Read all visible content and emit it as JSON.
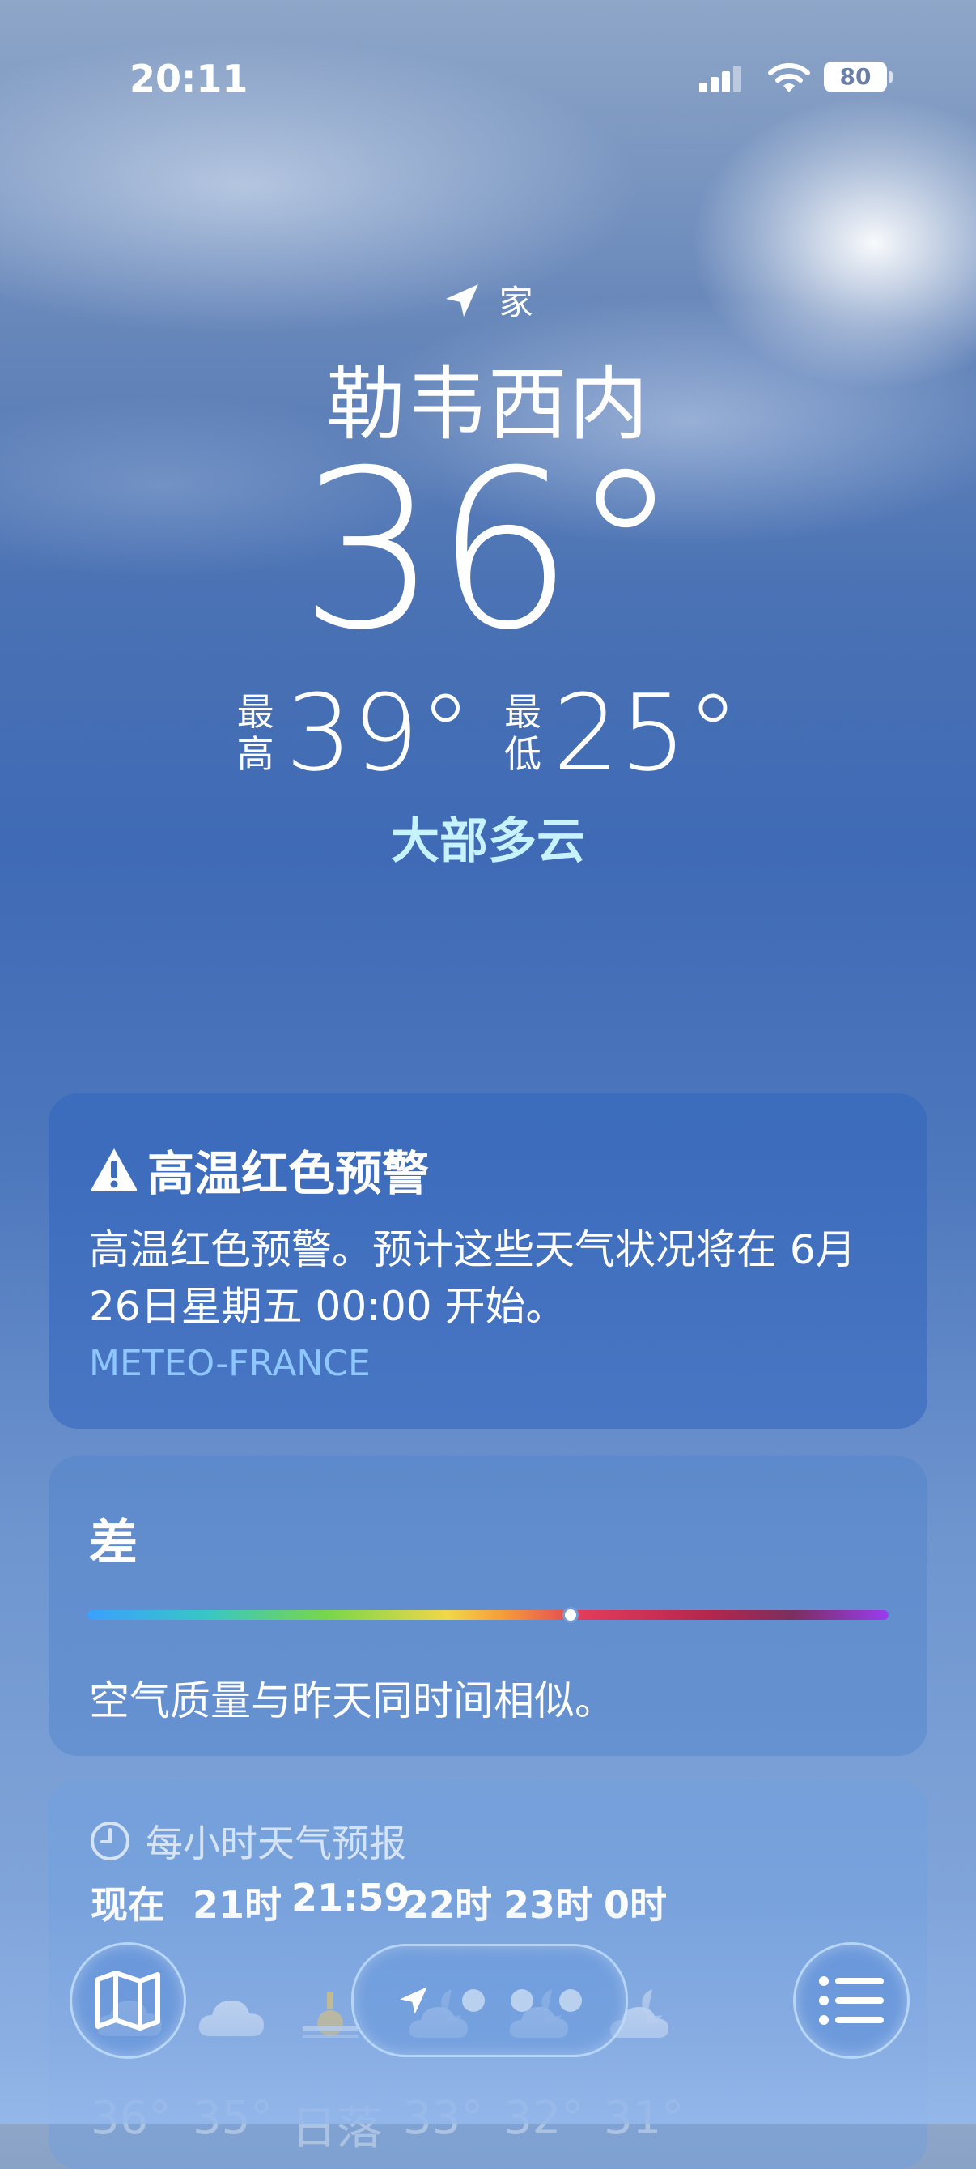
{
  "status_bar": {
    "time": "20:11",
    "battery": "80"
  },
  "header": {
    "location_label": "家",
    "city": "勒韦西内",
    "temperature": "36°",
    "high_label": "最高",
    "high_value": "39°",
    "low_label": "最低",
    "low_value": "25°",
    "condition": "大部多云"
  },
  "warning": {
    "title": "高温红色预警",
    "body": "高温红色预警。预计这些天气状况将在 6月26日星期五 00:00 开始。",
    "source": "METEO-FRANCE"
  },
  "air_quality": {
    "title": "差",
    "level_fraction": 0.6,
    "description": "空气质量与昨天同时间相似。"
  },
  "hourly": {
    "title": "每小时天气预报",
    "times": [
      "现在",
      "21时",
      "21:59",
      "22时",
      "23时",
      "0时"
    ],
    "icons": [
      "cloud-icon",
      "cloud-icon",
      "sunset-icon",
      "moon-cloud-icon",
      "moon-cloud-icon",
      "moon-cloud-icon"
    ],
    "temps": [
      "36°",
      "35°",
      "日落",
      "33°",
      "32°",
      "31°"
    ]
  },
  "bottom_bar": {
    "icons": [
      "map-icon",
      "location-arrow-icon",
      "list-icon"
    ],
    "page_count": 4
  },
  "colors": {
    "condition_text": "#c7f2ff",
    "source_text": "#8ec7ff"
  }
}
